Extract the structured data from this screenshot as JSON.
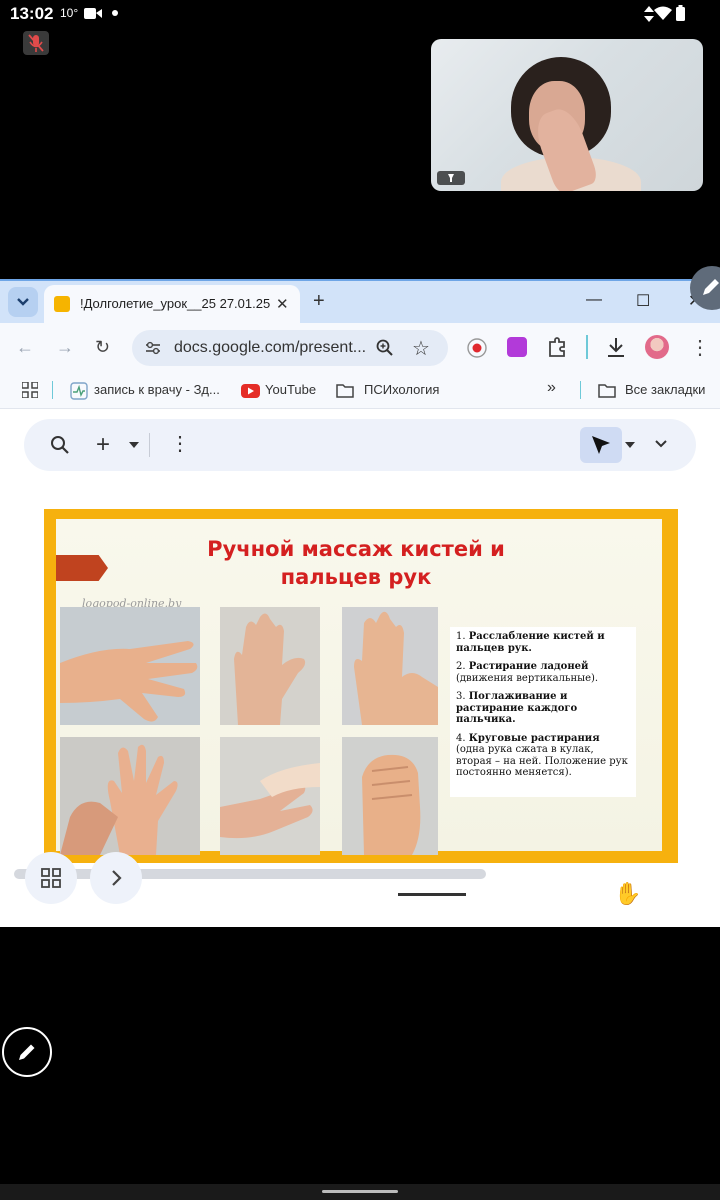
{
  "status_bar": {
    "time": "13:02",
    "temperature": "10°"
  },
  "browser": {
    "tab": {
      "title": "!Долголетие_урок__25 27.01.25"
    },
    "address": {
      "url": "docs.google.com/present..."
    },
    "bookmarks": {
      "items": [
        "запись к врачу - Зд...",
        "YouTube",
        "ПСИхология"
      ],
      "more": "»",
      "all": "Все закладки"
    }
  },
  "slide": {
    "title": "Ручной массаж кистей и пальцев рук",
    "watermark": "logopod-online.by",
    "steps": [
      {
        "num": "1.",
        "bold": "Расслабление кистей и пальцев рук.",
        "rest": ""
      },
      {
        "num": "2.",
        "bold": "Растирание ладоней",
        "rest": " (движения вертикальные)."
      },
      {
        "num": "3.",
        "bold": "Поглаживание и растирание каждого пальчика.",
        "rest": ""
      },
      {
        "num": "4.",
        "bold": "Круговые растирания",
        "rest": " (одна рука сжата в кулак, вторая – на ней. Положение рук постоянно меняется)."
      }
    ]
  },
  "colors": {
    "slide_border": "#f6b10e",
    "title_red": "#d42020",
    "chrome_blue": "#d2e3f9"
  }
}
